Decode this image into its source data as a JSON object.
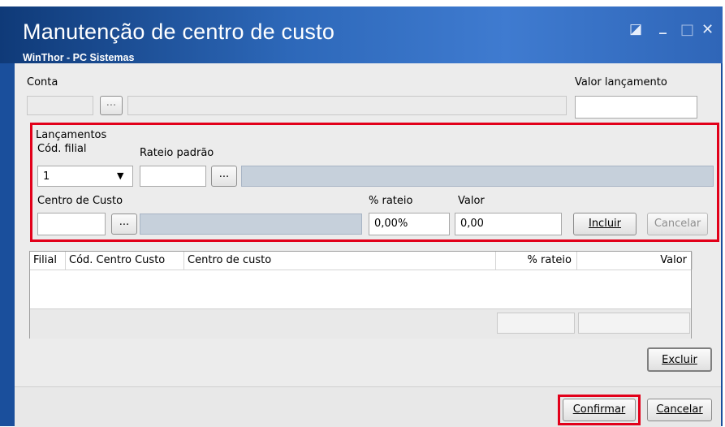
{
  "window": {
    "title": "Manutenção de centro de custo",
    "subtitle": "WinThor - PC Sistemas",
    "controls": {
      "restore": "◪",
      "minimize": "_",
      "maximize": "□",
      "close": "✕"
    }
  },
  "conta": {
    "label": "Conta",
    "lookup_button": "...",
    "value": "",
    "description": ""
  },
  "valor_lancamento": {
    "label": "Valor lançamento",
    "value": ""
  },
  "lancamentos": {
    "group_label": "Lançamentos",
    "cod_filial": {
      "label": "Cód. filial",
      "value": "1"
    },
    "rateio_padrao": {
      "label": "Rateio padrão",
      "value": "",
      "lookup_button": "...",
      "description": ""
    },
    "centro_custo": {
      "label": "Centro de Custo",
      "value": "",
      "lookup_button": "...",
      "description": ""
    },
    "percent_rateio": {
      "label": "% rateio",
      "value": "0,00%"
    },
    "valor": {
      "label": "Valor",
      "value": "0,00"
    },
    "incluir_button": "Incluir",
    "cancelar_button": "Cancelar"
  },
  "grid": {
    "columns": [
      "Filial",
      "Cód. Centro Custo",
      "Centro de custo",
      "% rateio",
      "Valor"
    ],
    "rows": [],
    "excluir_button": "Excluir"
  },
  "footer": {
    "confirmar_button": "Confirmar",
    "cancelar_button": "Cancelar"
  },
  "colors": {
    "title_bar": "#2d68b9",
    "highlight": "#e2001a",
    "disabled_field": "#c6d0db"
  }
}
